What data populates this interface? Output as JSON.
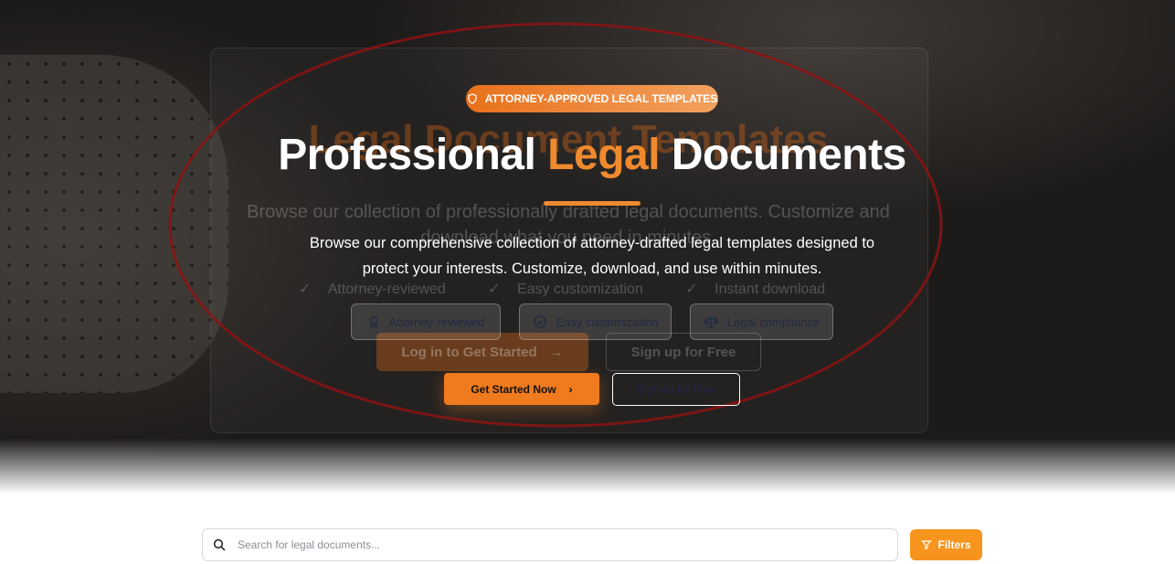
{
  "hero": {
    "badge": "ATTORNEY-APPROVED LEGAL TEMPLATES",
    "title_part1": "Professional",
    "title_accent": "Legal",
    "title_part2": "Documents",
    "subtitle": "Browse our comprehensive collection of attorney-drafted legal templates designed to protect your interests. Customize, download, and use within minutes.",
    "features": [
      {
        "label": "Attorney-reviewed",
        "icon": "award-icon"
      },
      {
        "label": "Easy customization",
        "icon": "check-circle-icon"
      },
      {
        "label": "Legal compliance",
        "icon": "scale-icon"
      }
    ],
    "primary_button": "Get Started Now",
    "secondary_button": "Sign up for Free",
    "accent_color": "#f08a2e",
    "ghost": {
      "title": "Legal Document Templates",
      "description": "Browse our collection of professionally drafted legal documents. Customize and download what you need in minutes.",
      "checks": [
        "Attorney-reviewed",
        "Easy customization",
        "Instant download"
      ],
      "login_button": "Log in to Get Started",
      "signup_button": "Sign up for Free"
    }
  },
  "search": {
    "placeholder": "Search for legal documents...",
    "filters_label": "Filters",
    "filters_color": "#f7941d"
  }
}
